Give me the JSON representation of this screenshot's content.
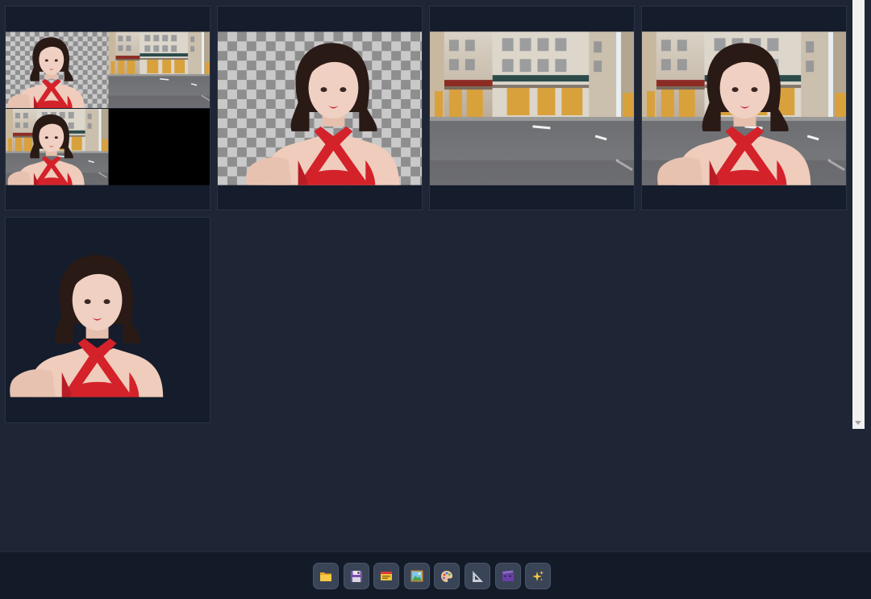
{
  "gallery": {
    "items": [
      {
        "name": "grid-composite",
        "kind": "composite-2x2"
      },
      {
        "name": "person-cutout-transparent",
        "kind": "cutout-on-checker"
      },
      {
        "name": "street-background",
        "kind": "background"
      },
      {
        "name": "person-on-street",
        "kind": "composite"
      },
      {
        "name": "person-cutout-dark",
        "kind": "cutout-on-dark"
      }
    ]
  },
  "toolbar": {
    "buttons": [
      {
        "name": "open-folder",
        "icon": "folder-icon"
      },
      {
        "name": "save",
        "icon": "floppy-disk-icon"
      },
      {
        "name": "card-index",
        "icon": "card-file-icon"
      },
      {
        "name": "image",
        "icon": "framed-picture-icon"
      },
      {
        "name": "palette",
        "icon": "palette-icon"
      },
      {
        "name": "ruler",
        "icon": "triangle-ruler-icon"
      },
      {
        "name": "film",
        "icon": "clapper-icon"
      },
      {
        "name": "sparkles",
        "icon": "sparkles-icon"
      }
    ]
  },
  "colors": {
    "background": "#1e2535",
    "card": "#151c2b",
    "toolbar": "#141b28",
    "button": "#3a4457",
    "dress": "#d4222a"
  }
}
